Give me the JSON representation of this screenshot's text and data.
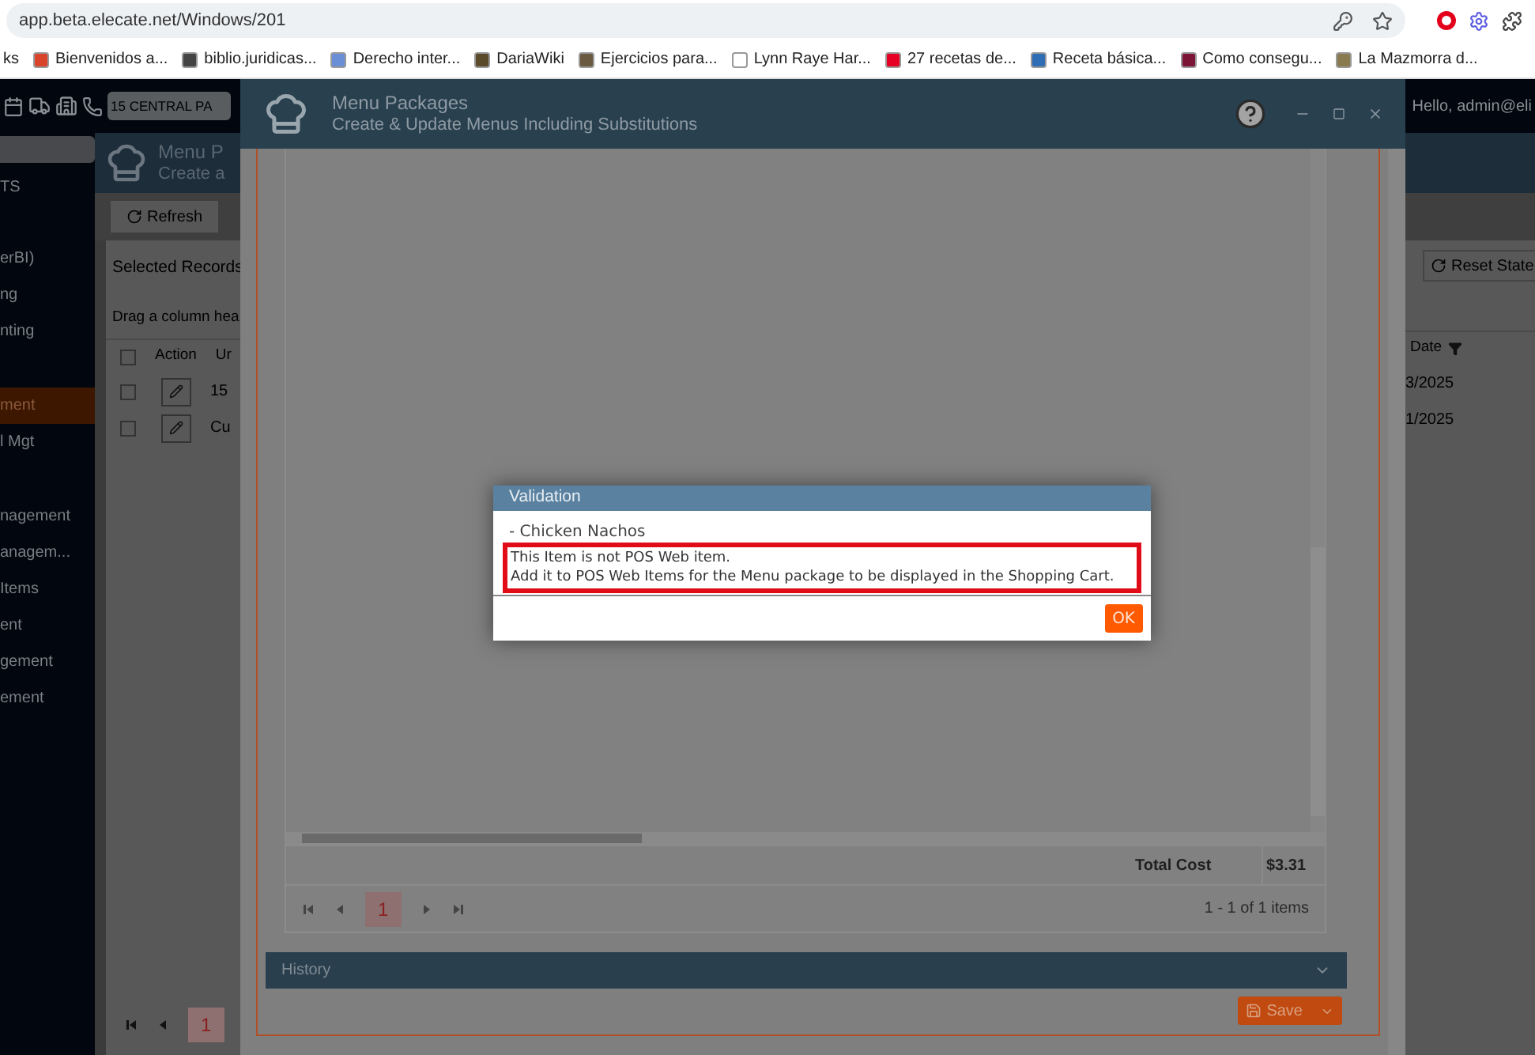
{
  "browser": {
    "url": "app.beta.elecate.net/Windows/201",
    "bookmarks": [
      {
        "label": "ks"
      },
      {
        "label": "Bienvenidos a...",
        "color": "#d9442b"
      },
      {
        "label": "biblio.juridicas...",
        "color": "#444444"
      },
      {
        "label": "Derecho inter...",
        "color": "#6b8fd6"
      },
      {
        "label": "DariaWiki",
        "color": "#5a4a2a"
      },
      {
        "label": "Ejercicios para...",
        "color": "#6a5a40"
      },
      {
        "label": "Lynn Raye Har...",
        "color": "#ffffff"
      },
      {
        "label": "27 recetas de...",
        "color": "#e60023"
      },
      {
        "label": "Receta básica...",
        "color": "#2f6db5"
      },
      {
        "label": "Como consegu...",
        "color": "#7a1535"
      },
      {
        "label": "La Mazmorra d...",
        "color": "#8a7a50"
      }
    ]
  },
  "app": {
    "location": "15 CENTRAL PA",
    "greeting": "Hello, admin@eli",
    "sidebar": {
      "items": [
        {
          "label": "TS",
          "selected": false
        },
        {
          "label": "erBI)",
          "selected": false
        },
        {
          "label": "ng",
          "selected": false
        },
        {
          "label": "nting",
          "selected": false
        },
        {
          "label": "ment",
          "selected": true
        },
        {
          "label": "l Mgt",
          "selected": false
        },
        {
          "label": "nagement",
          "selected": false
        },
        {
          "label": "anagem...",
          "selected": false
        },
        {
          "label": "Items",
          "selected": false
        },
        {
          "label": "ent",
          "selected": false
        },
        {
          "label": "gement",
          "selected": false
        },
        {
          "label": "ement",
          "selected": false
        }
      ]
    },
    "page": {
      "title": "Menu P",
      "subtitle": "Create a"
    },
    "toolbar": {
      "refresh": "Refresh",
      "reset_state": "Reset State"
    },
    "grid": {
      "title": "Selected Records",
      "group_hint": "Drag a column hea",
      "columns": [
        "Action",
        "Ur",
        "Date"
      ],
      "select_all": {
        "checked": false
      },
      "rows": [
        {
          "checked": false,
          "column_3": "15",
          "date": "3/2025"
        },
        {
          "checked": false,
          "column_3": "Cu",
          "date": "1/2025"
        }
      ],
      "page": "1"
    }
  },
  "window": {
    "title": "Menu Packages",
    "subtitle": "Create & Update Menus Including Substitutions",
    "grid": {
      "footer_label": "Total Cost",
      "footer_value": "$3.31",
      "page": "1",
      "summary": "1 - 1 of 1 items"
    },
    "history": "History",
    "save": "Save"
  },
  "dialog": {
    "title": "Validation",
    "item": "- Chicken Nachos",
    "lines": [
      "This Item is not POS Web item.",
      "Add it to POS Web Items for the Menu package to be displayed in the Shopping Cart."
    ],
    "ok": "OK"
  }
}
